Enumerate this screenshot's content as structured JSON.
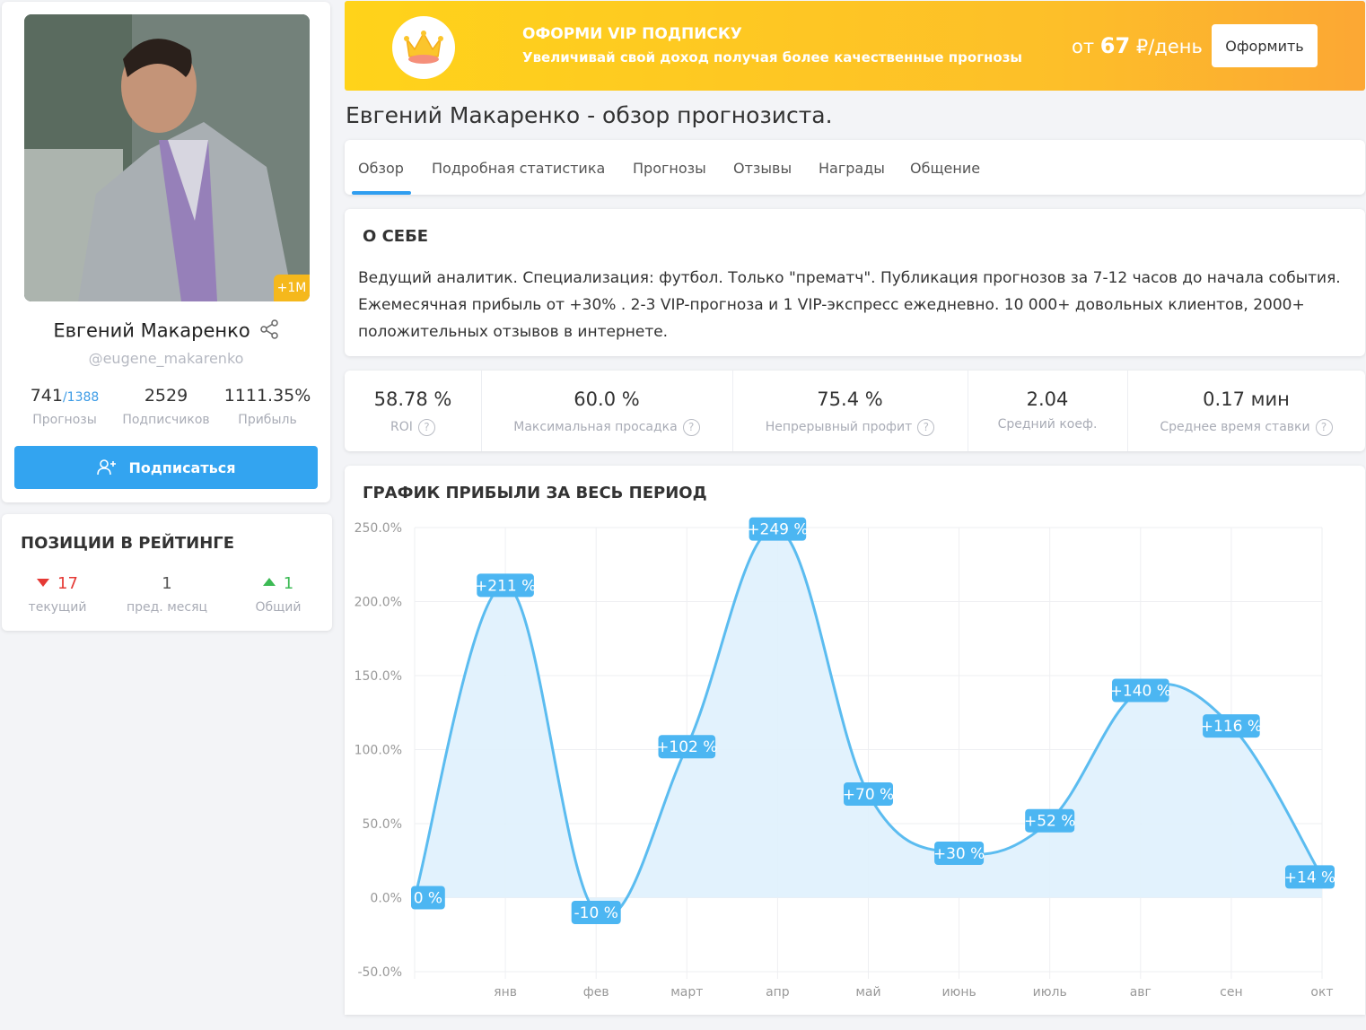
{
  "profile": {
    "name": "Евгений Макаренко",
    "handle": "@eugene_makarenko",
    "avatar_badge": "+1M",
    "forecasts_value": "741",
    "forecasts_total": "/1388",
    "forecasts_label": "Прогнозы",
    "subscribers_value": "2529",
    "subscribers_label": "Подписчиков",
    "profit_value": "1111.35%",
    "profit_label": "Прибыль",
    "subscribe_label": "Подписаться"
  },
  "rating": {
    "title": "ПОЗИЦИИ В РЕЙТИНГЕ",
    "current_value": "17",
    "current_label": "текущий",
    "prev_value": "1",
    "prev_label": "пред. месяц",
    "overall_value": "1",
    "overall_label": "Общий",
    "colors": {
      "down": "#e53935",
      "up": "#3cba54"
    }
  },
  "vip": {
    "title": "ОФОРМИ VIP ПОДПИСКУ",
    "subtitle": "Увеличивай свой доход получая более качественные прогнозы",
    "price_prefix": "от",
    "price_value": "67",
    "price_suffix": "₽/день",
    "button_label": "Оформить",
    "icon": "crown-icon"
  },
  "page_title": "Евгений Макаренко - обзор прогнозиста.",
  "tabs": [
    {
      "label": "Обзор",
      "active": true
    },
    {
      "label": "Подробная статистика"
    },
    {
      "label": "Прогнозы"
    },
    {
      "label": "Отзывы"
    },
    {
      "label": "Награды"
    },
    {
      "label": "Общение"
    }
  ],
  "about": {
    "title": "О СЕБЕ",
    "text": "Ведущий аналитик. Специализация: футбол. Только \"прематч\". Публикация прогнозов за 7-12 часов до начала события. Ежемесячная прибыль от +30% . 2-3 VIP-прогноза и 1 VIP-экспресс ежедневно. 10 000+ довольных клиентов, 2000+ положительных отзывов в интернете."
  },
  "stats": [
    {
      "value": "58.78 %",
      "label": "ROI",
      "help": true
    },
    {
      "value": "60.0 %",
      "label": "Максимальная просадка",
      "help": true
    },
    {
      "value": "75.4 %",
      "label": "Непрерывный профит",
      "help": true
    },
    {
      "value": "2.04",
      "label": "Средний коеф.",
      "help": false
    },
    {
      "value": "0.17 мин",
      "label": "Среднее время ставки",
      "help": true
    }
  ],
  "chart_title": "ГРАФИК ПРИБЫЛИ ЗА ВЕСЬ ПЕРИОД",
  "chart_data": {
    "type": "area",
    "title": "ГРАФИК ПРИБЫЛИ ЗА ВЕСЬ ПЕРИОД",
    "x": [
      "",
      "янв",
      "фев",
      "март",
      "апр",
      "май",
      "июнь",
      "июль",
      "авг",
      "сен",
      "окт"
    ],
    "values": [
      0,
      211,
      -10,
      102,
      249,
      70,
      30,
      52,
      140,
      116,
      14
    ],
    "data_labels": [
      "0 %",
      "+211 %",
      "-10 %",
      "+102 %",
      "+249 %",
      "+70 %",
      "+30 %",
      "+52 %",
      "+140 %",
      "+116 %",
      "+14 %"
    ],
    "y_ticks": [
      "250.0%",
      "200.0%",
      "150.0%",
      "100.0%",
      "50.0%",
      "0.0%",
      "-50.0%"
    ],
    "y_tick_values": [
      250,
      200,
      150,
      100,
      50,
      0,
      -50
    ],
    "ylim": [
      -50,
      250
    ],
    "grid": true,
    "colors": {
      "line": "#5bbcf0",
      "fill": "#dff1fd",
      "label_bg": "#4cb6f2"
    }
  }
}
